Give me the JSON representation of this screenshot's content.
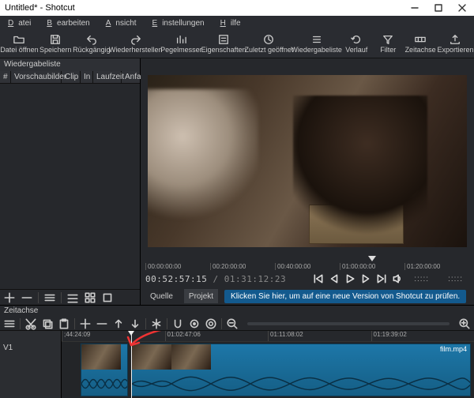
{
  "window": {
    "title": "Untitled* - Shotcut"
  },
  "menu": {
    "file": "Datei",
    "file_u": "D",
    "edit": "Bearbeiten",
    "edit_u": "B",
    "view": "Ansicht",
    "view_u": "A",
    "settings": "Einstellungen",
    "settings_u": "E",
    "help": "Hilfe",
    "help_u": "H"
  },
  "toolbar": [
    {
      "id": "open",
      "label": "Datei öffnen"
    },
    {
      "id": "save",
      "label": "Speichern"
    },
    {
      "id": "undo",
      "label": "Rückgängig"
    },
    {
      "id": "redo",
      "label": "Wiederherstellen"
    },
    {
      "id": "peakmeter",
      "label": "Pegelmesser"
    },
    {
      "id": "properties",
      "label": "Eigenschaften"
    },
    {
      "id": "recent",
      "label": "Zuletzt geöffnet"
    },
    {
      "id": "playlist",
      "label": "Wiedergabeliste"
    },
    {
      "id": "history",
      "label": "Verlauf"
    },
    {
      "id": "filter",
      "label": "Filter"
    },
    {
      "id": "timeline",
      "label": "Zeitachse"
    },
    {
      "id": "export",
      "label": "Exportieren"
    }
  ],
  "playlist": {
    "title": "Wiedergabeliste",
    "cols": [
      "#",
      "Vorschaubilder",
      "Clip",
      "In",
      "Laufzeit",
      "Anfan"
    ]
  },
  "ruler": [
    "00:00:00:00",
    "00:20:00:00",
    "00:40:00:00",
    "01:00:00:00",
    "01:20:00:00"
  ],
  "timecode": {
    "current": "00:52:57:15",
    "total": "01:31:12:23"
  },
  "tabs": {
    "source": "Quelle",
    "project": "Projekt"
  },
  "banner": "Klicken Sie hier, um auf eine neue Version von Shotcut zu prüfen.",
  "timeline": {
    "title": "Zeitachse",
    "ruler": [
      ";44:24:09",
      "01:02:47:06",
      "01:11:08:02",
      "01:19:39:02"
    ],
    "track": "V1",
    "clip_label": "film.mp4"
  }
}
